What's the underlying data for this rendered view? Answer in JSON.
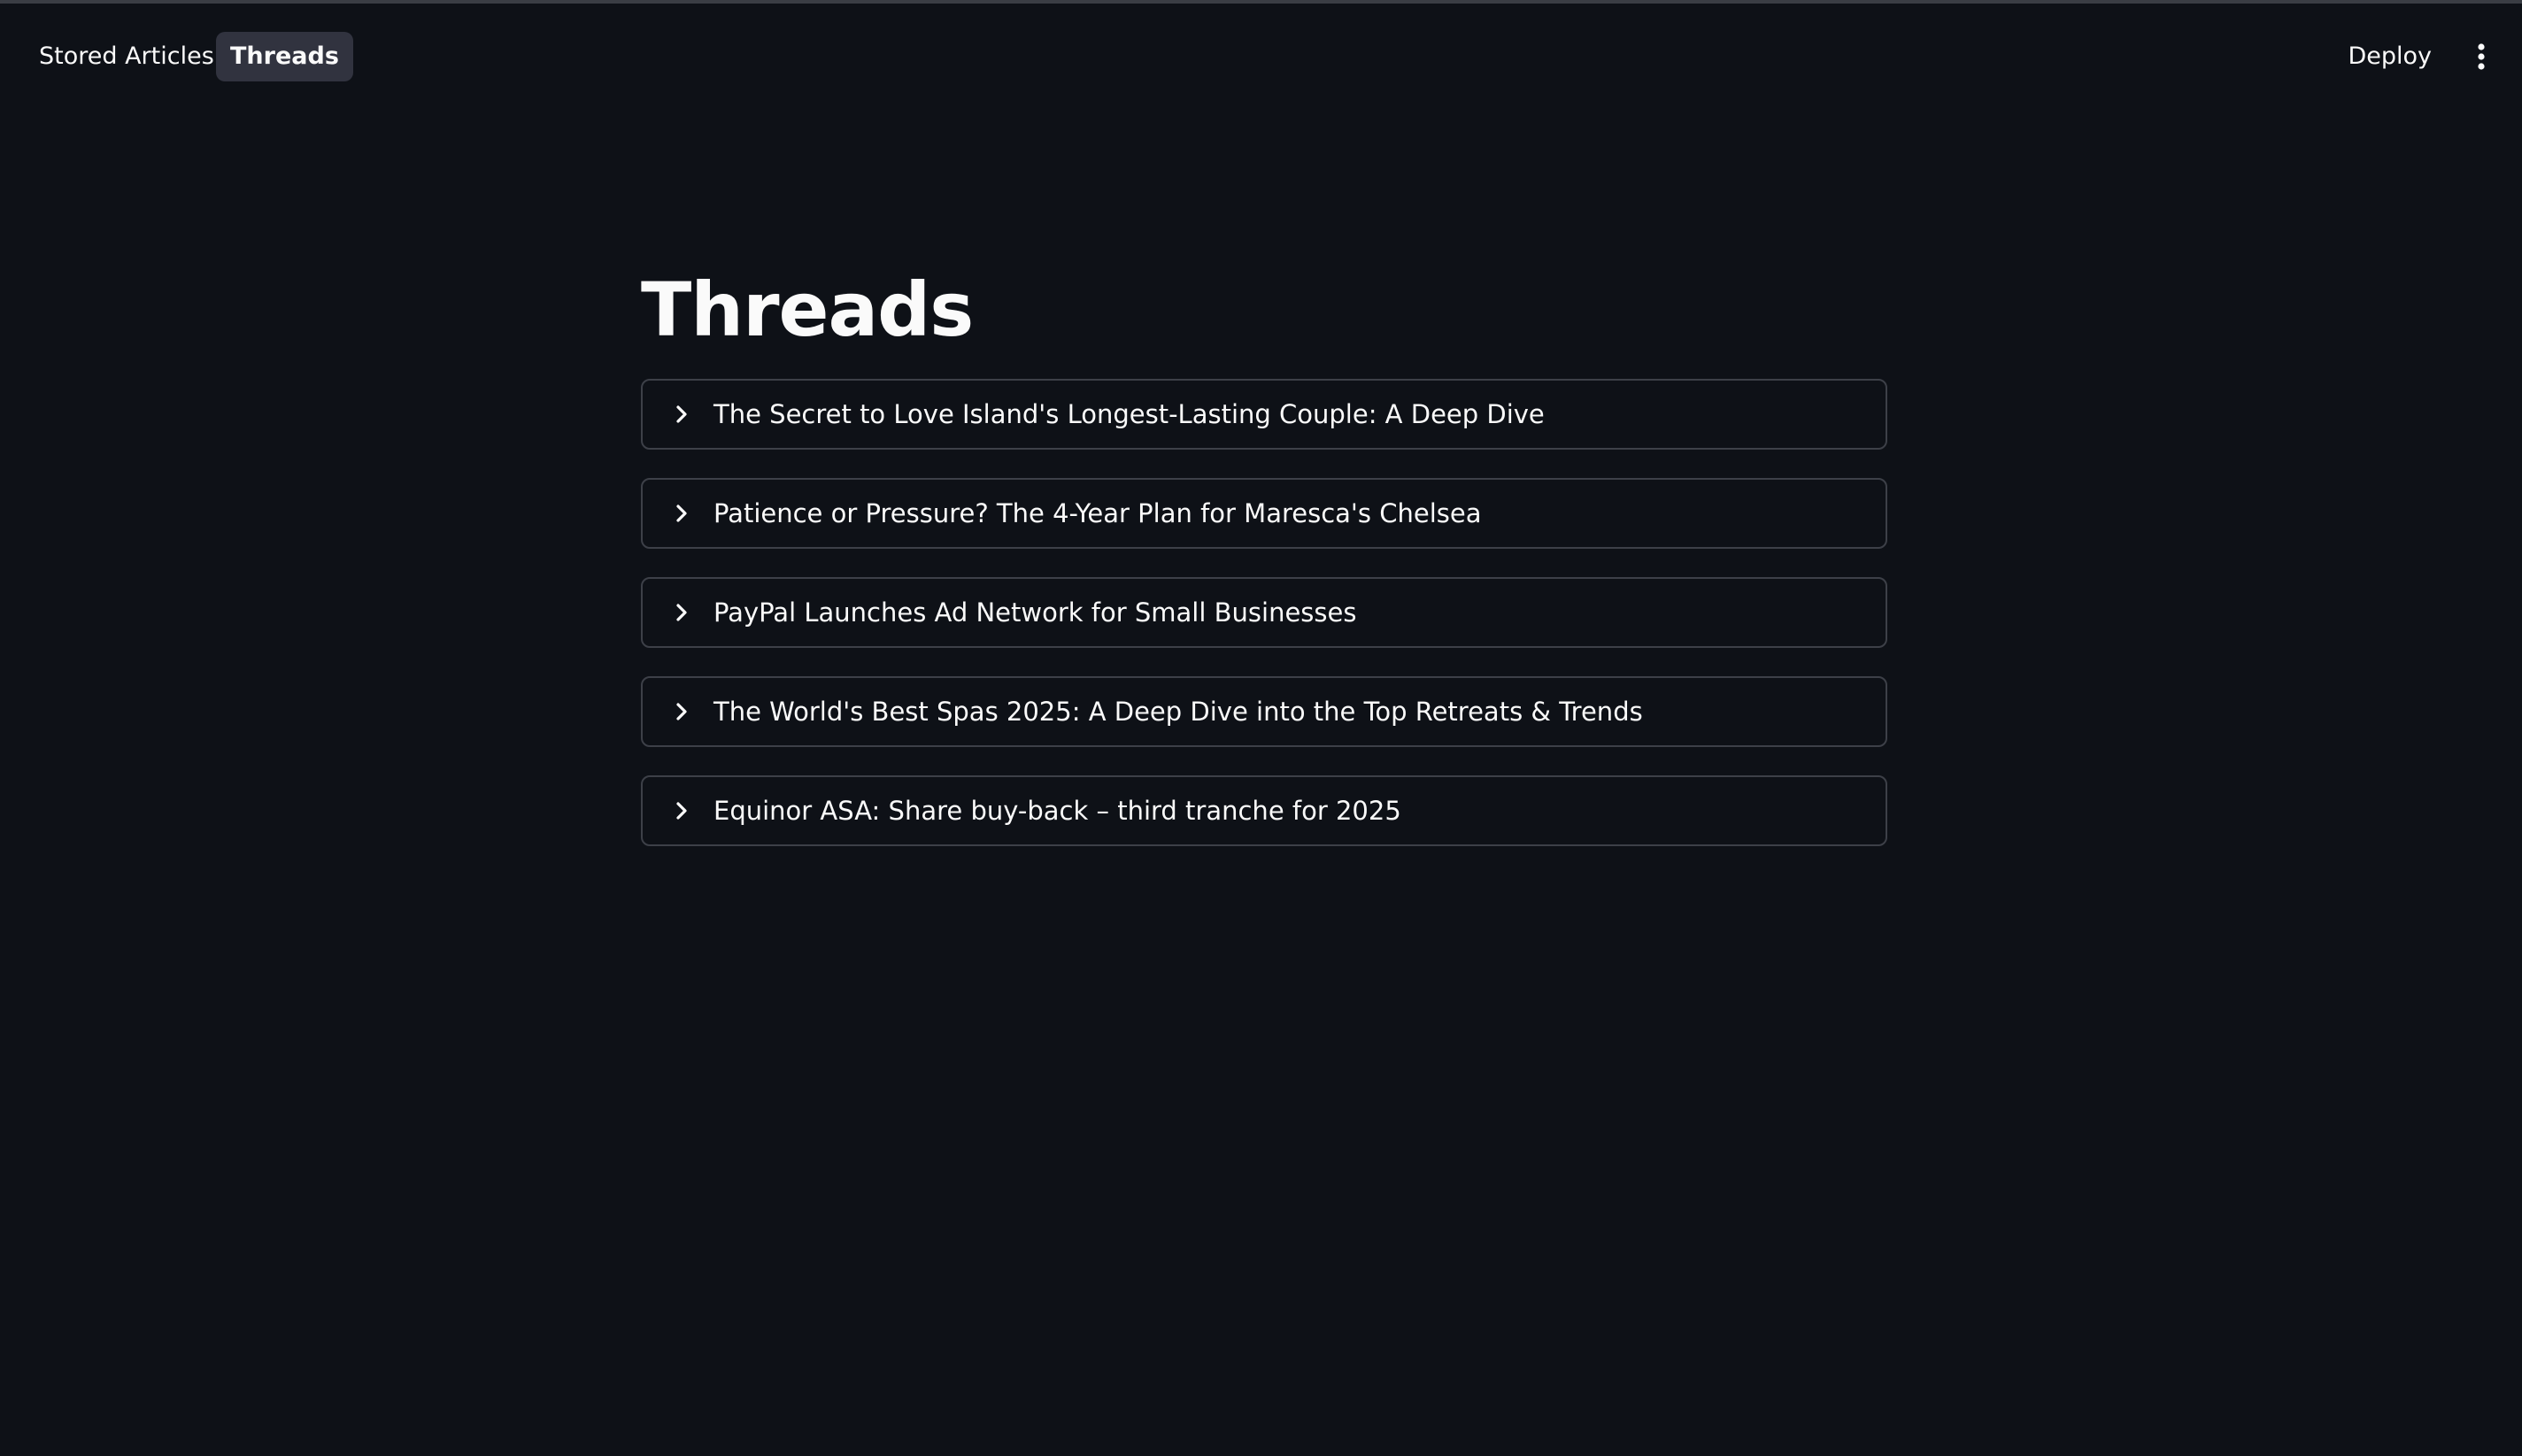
{
  "nav": {
    "items": [
      {
        "label": "Stored Articles",
        "active": false
      },
      {
        "label": "Threads",
        "active": true
      }
    ]
  },
  "header": {
    "deploy_label": "Deploy",
    "menu_icon": "more-vertical-icon"
  },
  "main": {
    "title": "Threads",
    "threads": [
      {
        "title": "The Secret to Love Island's Longest-Lasting Couple: A Deep Dive"
      },
      {
        "title": "Patience or Pressure? The 4-Year Plan for Maresca's Chelsea"
      },
      {
        "title": "PayPal Launches Ad Network for Small Businesses"
      },
      {
        "title": "The World's Best Spas 2025: A Deep Dive into the Top Retreats & Trends"
      },
      {
        "title": "Equinor ASA: Share buy-back – third tranche for 2025"
      }
    ]
  },
  "colors": {
    "background": "#0e1117",
    "active_nav_bg": "#31333f",
    "border": "#3d4048",
    "text": "#fafafa"
  }
}
